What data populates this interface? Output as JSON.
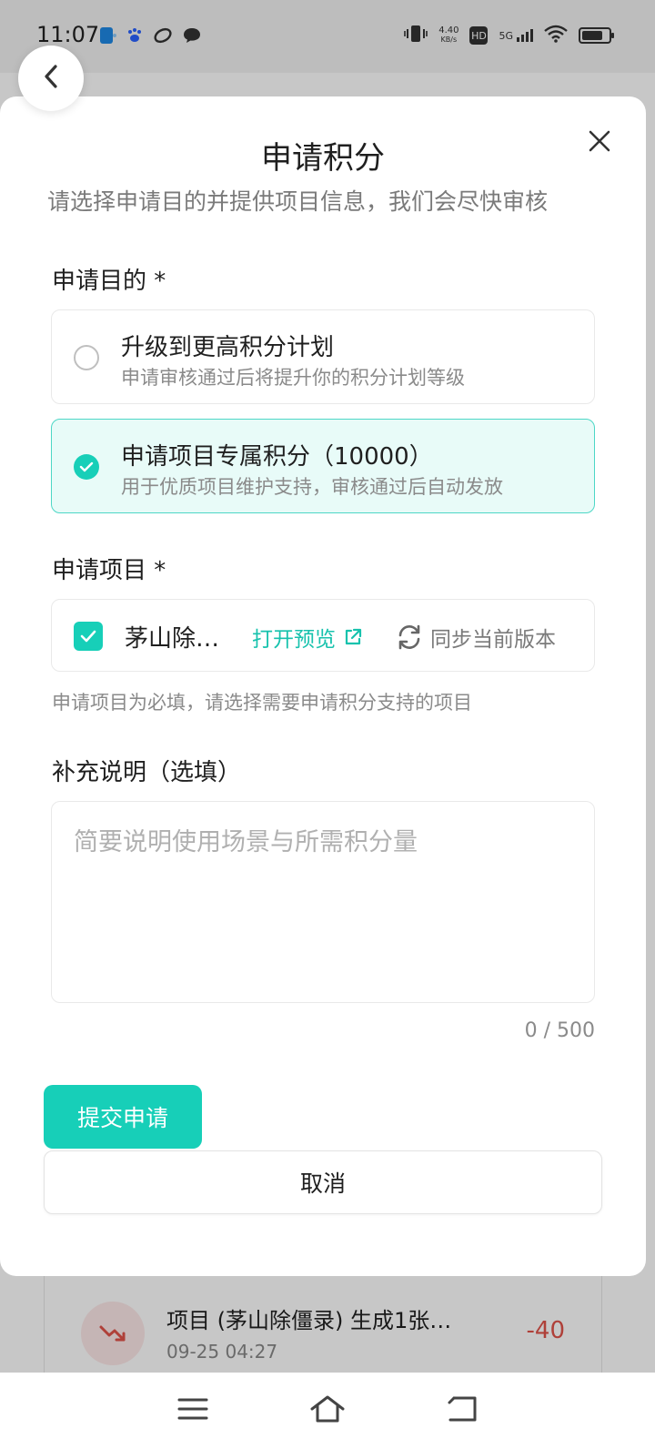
{
  "status_bar": {
    "time": "11:07",
    "net_speed": "4.40",
    "net_unit": "KB/s",
    "hd": "HD",
    "network": "5G"
  },
  "modal": {
    "title": "申请积分",
    "subtitle": "请选择申请目的并提供项目信息，我们会尽快审核",
    "purpose_label": "申请目的 *",
    "options": [
      {
        "title": "升级到更高积分计划",
        "desc": "申请审核通过后将提升你的积分计划等级",
        "selected": false
      },
      {
        "title": "申请项目专属积分（10000）",
        "desc": "用于优质项目维护支持，审核通过后自动发放",
        "selected": true
      }
    ],
    "project_label": "申请项目 *",
    "project": {
      "name": "茅山除…",
      "preview_label": "打开预览",
      "sync_label": "同步当前版本",
      "checked": true
    },
    "project_hint": "申请项目为必填，请选择需要申请积分支持的项目",
    "note_label": "补充说明（选填）",
    "note_placeholder": "简要说明使用场景与所需积分量",
    "note_value": "",
    "counter": "0 / 500",
    "submit_label": "提交申请",
    "cancel_label": "取消"
  },
  "background": {
    "item_title": "项目 (茅山除僵录) 生成1张…",
    "item_time": "09-25 04:27",
    "item_value": "-40"
  },
  "colors": {
    "accent": "#17cfb8",
    "selected_bg": "#e8fbf8",
    "negative": "#e0534a"
  }
}
